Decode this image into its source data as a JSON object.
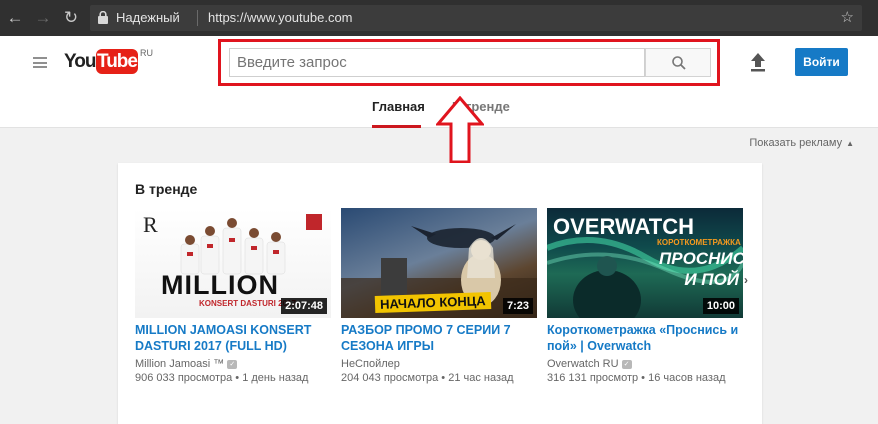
{
  "browser": {
    "security_label": "Надежный",
    "url": "https://www.youtube.com"
  },
  "header": {
    "logo_you": "You",
    "logo_tube": "Tube",
    "logo_region": "RU",
    "search_placeholder": "Введите запрос",
    "signin_label": "Войти"
  },
  "tabs": [
    {
      "label": "Главная",
      "active": true
    },
    {
      "label": "В тренде",
      "active": false
    }
  ],
  "ads_toggle": "Показать рекламу",
  "section": {
    "title": "В тренде",
    "videos": [
      {
        "thumb_text": "MILLION",
        "thumb_subtext": "KONSERT DASTURI 2017",
        "duration": "2:07:48",
        "title": "MILLION JAMOASI KONSERT DASTURI 2017 (FULL HD)",
        "channel": "Million Jamoasi ™",
        "views": "906 033 просмотра",
        "age": "1 день назад"
      },
      {
        "thumb_text": "НАЧАЛО КОНЦА",
        "duration": "7:23",
        "title": "РАЗБОР ПРОМО 7 СЕРИИ 7 СЕЗОНА ИГРЫ",
        "channel": "НеСпойлер",
        "views": "204 043 просмотра",
        "age": "21 час назад"
      },
      {
        "thumb_text": "OVERWATCH",
        "thumb_subtext": "КОРОТКОМЕТРАЖКА",
        "thumb_caption": "ПРОСНИСЬ И ПОЙ",
        "duration": "10:00",
        "title": "Короткометражка «Проснись и пой» | Overwatch",
        "channel": "Overwatch RU",
        "views": "316 131 просмотр",
        "age": "16 часов назад"
      }
    ]
  },
  "colors": {
    "brand_red": "#e62117",
    "link_blue": "#167ac6",
    "annotation_red": "#e0141e"
  }
}
